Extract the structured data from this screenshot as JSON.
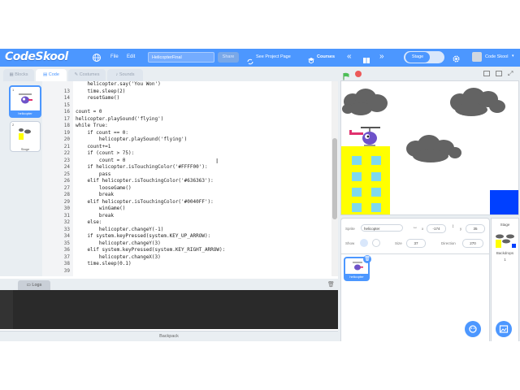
{
  "menubar": {
    "brand": "CodeSkool",
    "file": "File",
    "edit": "Edit",
    "project_title": "HelicopterFinal",
    "share": "Share",
    "see_project_page": "See Project Page",
    "courses": "Courses",
    "stage_toggle": "Stage",
    "account": "Code Skool",
    "bg": "#4c97ff"
  },
  "tabs": [
    {
      "label": "Blocks"
    },
    {
      "label": "Code"
    },
    {
      "label": "Costumes"
    },
    {
      "label": "Sounds"
    }
  ],
  "sprites_column": [
    {
      "num": "1",
      "name": "helicopter"
    },
    {
      "num": "2",
      "name": "Stage"
    }
  ],
  "code": {
    "lines": [
      {
        "n": "",
        "t": "    helicopter.say('You Won')"
      },
      {
        "n": "13",
        "t": "    time.sleep(2)"
      },
      {
        "n": "14",
        "t": "    resetGame()"
      },
      {
        "n": "15",
        "t": ""
      },
      {
        "n": "16",
        "t": "count = 0"
      },
      {
        "n": "17",
        "t": "helicopter.playSound('flying')"
      },
      {
        "n": "18",
        "t": "while True:"
      },
      {
        "n": "19",
        "t": "    if count == 0:"
      },
      {
        "n": "20",
        "t": "        helicopter.playSound('flying')"
      },
      {
        "n": "21",
        "t": "    count+=1"
      },
      {
        "n": "22",
        "t": "    if (count > 75):"
      },
      {
        "n": "23",
        "t": "        count = 0"
      },
      {
        "n": "24",
        "t": "    if helicopter.isTouchingColor('#FFFF00'):"
      },
      {
        "n": "25",
        "t": "        pass"
      },
      {
        "n": "26",
        "t": "    elif helicopter.isTouchingColor('#636363'):"
      },
      {
        "n": "27",
        "t": "        looseGame()"
      },
      {
        "n": "28",
        "t": "        break"
      },
      {
        "n": "29",
        "t": "    elif helicopter.isTouchingColor('#0040FF'):"
      },
      {
        "n": "30",
        "t": "        winGame()"
      },
      {
        "n": "31",
        "t": "        break"
      },
      {
        "n": "32",
        "t": "    else:"
      },
      {
        "n": "33",
        "t": "        helicopter.changeY(-1)"
      },
      {
        "n": "34",
        "t": "    if system.keyPressed(system.KEY_UP_ARROW):"
      },
      {
        "n": "35",
        "t": "        helicopter.changeY(3)"
      },
      {
        "n": "36",
        "t": "    elif system.keyPressed(system.KEY_RIGHT_ARROW):"
      },
      {
        "n": "37",
        "t": "        helicopter.changeX(3)"
      },
      {
        "n": "38",
        "t": "    time.sleep(0.1)"
      },
      {
        "n": "39",
        "t": ""
      }
    ]
  },
  "logs": {
    "label": "Logs"
  },
  "backpack": {
    "label": "Backpack"
  },
  "sprite_info": {
    "sprite_label": "Sprite",
    "sprite_name": "helicopter",
    "x_label": "x",
    "x": "-174",
    "y_label": "y",
    "y": "35",
    "show_label": "Show",
    "size_label": "Size",
    "size": "37",
    "direction_label": "Direction",
    "direction": "270"
  },
  "sprite_list": [
    {
      "name": "helicopter"
    }
  ],
  "stage_panel": {
    "title": "Stage",
    "backdrops_label": "Backdrops",
    "backdrops_count": "1"
  },
  "colors": {
    "building": "#FFFF00",
    "cloud": "#636363",
    "goal": "#0040FF",
    "window": "#7fd9ee"
  },
  "icons": [
    "globe-icon",
    "courses-icon",
    "chevron-left-icon",
    "book-icon",
    "chevron-right-icon",
    "gear-icon",
    "avatar",
    "green-flag-icon",
    "stop-icon",
    "trash-icon",
    "choose-sprite-icon",
    "choose-backdrop-icon"
  ]
}
